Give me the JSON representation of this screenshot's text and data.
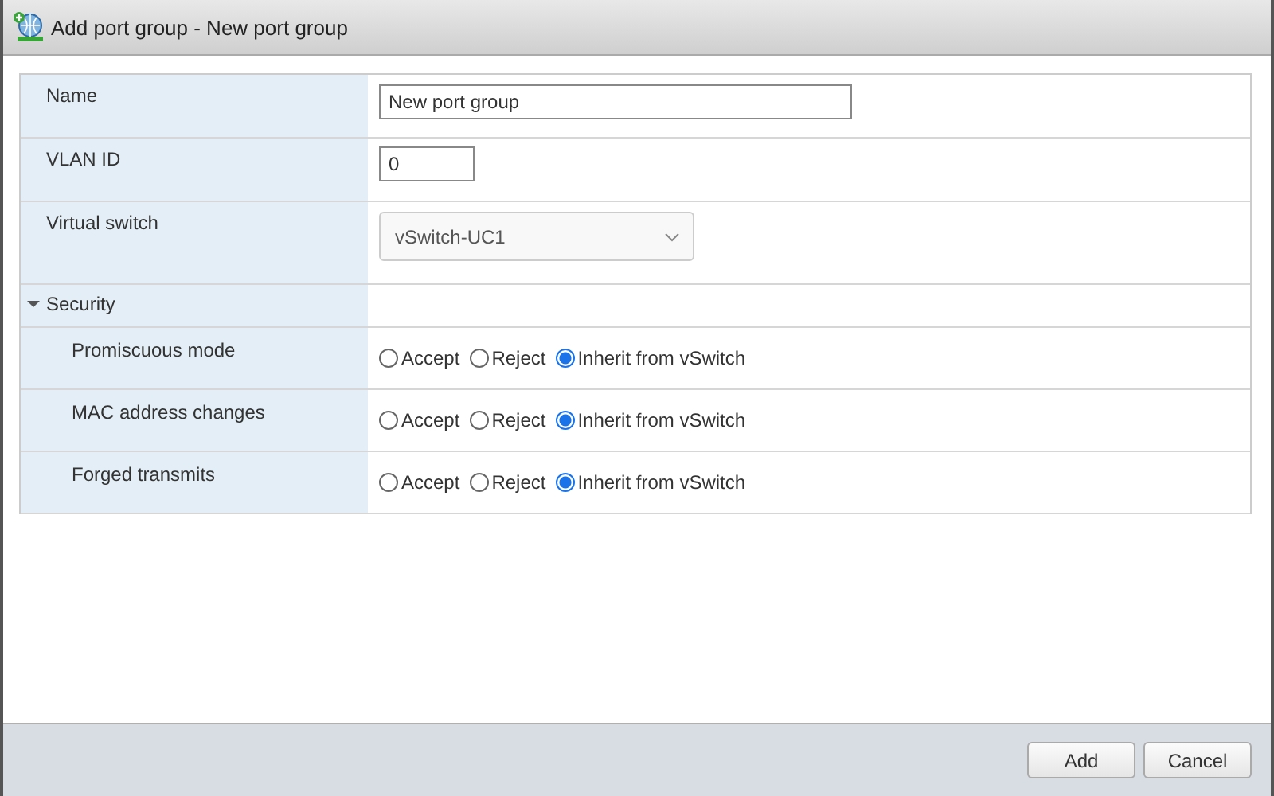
{
  "window": {
    "title": "Add port group - New port group"
  },
  "rows": [
    {
      "kind": "text",
      "label": "Name",
      "value": "New port group"
    },
    {
      "kind": "number",
      "label": "VLAN ID",
      "value": "0"
    },
    {
      "kind": "select",
      "label": "Virtual switch",
      "value": "vSwitch-UC1"
    },
    {
      "kind": "section",
      "label": "Security",
      "expanded": true,
      "children": [
        {
          "kind": "radio",
          "label": "Promiscuous mode",
          "options": [
            {
              "label": "Accept",
              "selected": false
            },
            {
              "label": "Reject",
              "selected": false
            },
            {
              "label": "Inherit from vSwitch",
              "selected": true
            }
          ]
        },
        {
          "kind": "radio",
          "label": "MAC address changes",
          "options": [
            {
              "label": "Accept",
              "selected": false
            },
            {
              "label": "Reject",
              "selected": false
            },
            {
              "label": "Inherit from vSwitch",
              "selected": true
            }
          ]
        },
        {
          "kind": "radio",
          "label": "Forged transmits",
          "options": [
            {
              "label": "Accept",
              "selected": false
            },
            {
              "label": "Reject",
              "selected": false
            },
            {
              "label": "Inherit from vSwitch",
              "selected": true
            }
          ]
        }
      ]
    }
  ],
  "buttons": [
    "Add",
    "Cancel"
  ]
}
